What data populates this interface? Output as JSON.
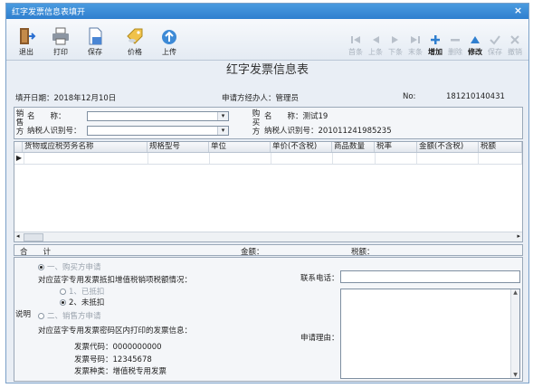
{
  "window": {
    "title": "红字发票信息表填开",
    "close": "×"
  },
  "toolbar": {
    "left": [
      {
        "label": "退出",
        "icon": "exit-door-icon"
      },
      {
        "label": "打印",
        "icon": "printer-icon"
      },
      {
        "label": "保存",
        "icon": "save-document-icon"
      },
      {
        "label": "价格",
        "icon": "price-tag-icon"
      },
      {
        "label": "上传",
        "icon": "upload-icon"
      }
    ],
    "right": [
      {
        "label": "首条",
        "icon": "first-icon",
        "enabled": false
      },
      {
        "label": "上条",
        "icon": "prev-icon",
        "enabled": false
      },
      {
        "label": "下条",
        "icon": "next-icon",
        "enabled": false
      },
      {
        "label": "末条",
        "icon": "last-icon",
        "enabled": false
      },
      {
        "label": "增加",
        "icon": "add-icon",
        "enabled": true
      },
      {
        "label": "删除",
        "icon": "remove-icon",
        "enabled": false
      },
      {
        "label": "修改",
        "icon": "edit-icon",
        "enabled": true
      },
      {
        "label": "保存",
        "icon": "check-icon",
        "enabled": false
      },
      {
        "label": "撤销",
        "icon": "cancel-icon",
        "enabled": false
      }
    ]
  },
  "form": {
    "title": "红字发票信息表",
    "fill_date": "填开日期：2018年12月10日",
    "applicant": "申请方经办人：管理员",
    "number_label": "No:",
    "number": "181210140431"
  },
  "seller": {
    "side_label": "销售方",
    "name_label": "名　　称：",
    "taxid_label": "纳税人识别号："
  },
  "buyer": {
    "side_label": "购买方",
    "name": "名　　称：测试19",
    "taxid": "纳税人识别号：201011241985235"
  },
  "grid": {
    "columns": [
      "货物或应税劳务名称",
      "规格型号",
      "单位",
      "单价(不含税)",
      "商品数量",
      "税率",
      "金额(不含税)",
      "税额"
    ]
  },
  "totals": {
    "label": "合　　计",
    "amount_label": "金额：",
    "tax_label": "税额："
  },
  "notes": {
    "side_label": "说明",
    "option1": "一、购买方申请",
    "question": "对应蓝字专用发票抵扣增值税销项税额情况：",
    "sub1": "1、已抵扣",
    "sub2": "2、未抵扣",
    "option2": "二、销售方申请",
    "invoice_info": "对应蓝字专用发票密码区内打印的发票信息：",
    "code": "发票代码：0000000000",
    "number": "发票号码：12345678",
    "kind": "发票种类：增值税专用发票",
    "phone_label": "联系电话：",
    "reason_label": "申请理由："
  },
  "colors": {
    "titlebar": "#2f7fcf",
    "accent_blue": "#2f7fcf"
  }
}
